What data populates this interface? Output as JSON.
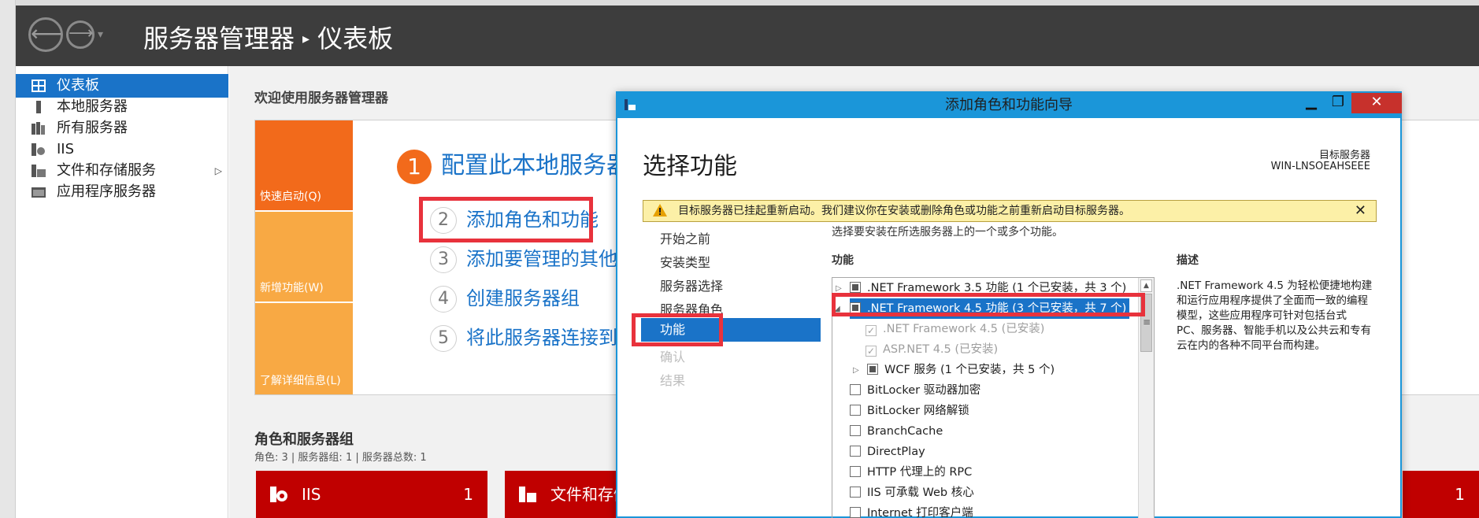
{
  "header": {
    "back": "⟵",
    "forward": "⟶",
    "history": "▾",
    "app_name": "服务器管理器",
    "separator": "▸",
    "page": "仪表板"
  },
  "sidebar": {
    "items": [
      {
        "label": "仪表板",
        "icon": "dashboard-icon"
      },
      {
        "label": "本地服务器",
        "icon": "server-icon"
      },
      {
        "label": "所有服务器",
        "icon": "servers-icon"
      },
      {
        "label": "IIS",
        "icon": "iis-icon"
      },
      {
        "label": "文件和存储服务",
        "icon": "storage-icon",
        "expand": "▷"
      },
      {
        "label": "应用程序服务器",
        "icon": "app-server-icon"
      }
    ]
  },
  "main": {
    "welcome": "欢迎使用服务器管理器",
    "tiles": {
      "quick_start": "快速启动(Q)",
      "whats_new": "新增功能(W)",
      "learn_more": "了解详细信息(L)"
    },
    "steps": [
      {
        "num": "1",
        "label": "配置此本地服务器"
      },
      {
        "num": "2",
        "label": "添加角色和功能"
      },
      {
        "num": "3",
        "label": "添加要管理的其他服务器"
      },
      {
        "num": "4",
        "label": "创建服务器组"
      },
      {
        "num": "5",
        "label": "将此服务器连接到云服务"
      }
    ],
    "roles_title": "角色和服务器组",
    "roles_subtitle": "角色: 3 | 服务器组: 1 | 服务器总数: 1",
    "cards": [
      {
        "label": "IIS",
        "count": "1"
      },
      {
        "label": "文件和存储服务",
        "count": "1"
      },
      {
        "label": "",
        "count": "1"
      }
    ]
  },
  "wizard": {
    "title": "添加角色和功能向导",
    "min": "▁",
    "max": "❐",
    "close": "✕",
    "heading": "选择功能",
    "dest_label": "目标服务器",
    "dest_name": "WIN-LNSOEAHSEEE",
    "warning": "目标服务器已挂起重新启动。我们建议你在安装或删除角色或功能之前重新启动目标服务器。",
    "warning_close": "✕",
    "nav": {
      "before": "开始之前",
      "install_type": "安装类型",
      "server_select": "服务器选择",
      "server_roles": "服务器角色",
      "features": "功能",
      "confirm": "确认",
      "results": "结果"
    },
    "instruction": "选择要安装在所选服务器上的一个或多个功能。",
    "features_label": "功能",
    "description_label": "描述",
    "description": ".NET Framework 4.5 为轻松便捷地构建和运行应用程序提供了全面而一致的编程模型，这些应用程序可针对包括台式 PC、服务器、智能手机以及公共云和专有云在内的各种不同平台而构建。",
    "tree": [
      {
        "label": ".NET Framework 3.5 功能 (1 个已安装，共 3 个)",
        "state": "partial",
        "expander": "▷"
      },
      {
        "label": ".NET Framework 4.5 功能 (3 个已安装，共 7 个)",
        "state": "partial",
        "expander": "◢",
        "selected": true
      },
      {
        "label": ".NET Framework 4.5 (已安装)",
        "state": "checked",
        "check": "✓"
      },
      {
        "label": "ASP.NET 4.5 (已安装)",
        "state": "checked",
        "check": "✓"
      },
      {
        "label": "WCF 服务 (1 个已安装，共 5 个)",
        "state": "partial",
        "expander": "▷"
      },
      {
        "label": "BitLocker 驱动器加密",
        "state": "empty"
      },
      {
        "label": "BitLocker 网络解锁",
        "state": "empty"
      },
      {
        "label": "BranchCache",
        "state": "empty"
      },
      {
        "label": "DirectPlay",
        "state": "empty"
      },
      {
        "label": "HTTP 代理上的 RPC",
        "state": "empty"
      },
      {
        "label": "IIS 可承载 Web 核心",
        "state": "empty"
      },
      {
        "label": "Internet 打印客户端",
        "state": "empty"
      }
    ],
    "scroll_up": "▲",
    "scroll_grip": "≡"
  },
  "colors": {
    "accent_blue": "#1a73c8",
    "dialog_blue": "#1b96d9",
    "orange": "#f26a1b",
    "light_orange": "#f8a944",
    "role_red": "#c00000",
    "highlight_red": "#e8323c"
  }
}
